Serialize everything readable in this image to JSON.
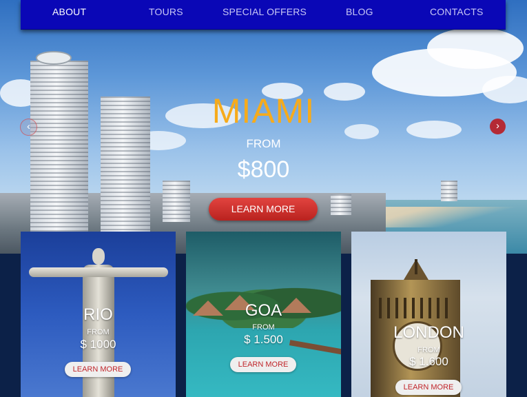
{
  "nav": {
    "items": [
      {
        "label": "ABOUT",
        "active": true
      },
      {
        "label": "TOURS",
        "active": false
      },
      {
        "label": "SPECIAL OFFERS",
        "active": false
      },
      {
        "label": "BLOG",
        "active": false
      },
      {
        "label": "CONTACTS",
        "active": false
      }
    ]
  },
  "hero": {
    "city": "MIAMI",
    "from_label": "FROM",
    "price": "$800",
    "button_label": "LEARN MORE",
    "prev_icon": "‹",
    "next_icon": "›"
  },
  "cards": [
    {
      "city": "RIO",
      "from_label": "FROM",
      "price": "$ 1000",
      "button_label": "LEARN MORE"
    },
    {
      "city": "GOA",
      "from_label": "FROM",
      "price": "$ 1.500",
      "button_label": "LEARN MORE"
    },
    {
      "city": "LONDON",
      "from_label": "FROM",
      "price": "$ 1.600",
      "button_label": "LEARN MORE"
    }
  ],
  "colors": {
    "nav_bg": "#0a07b6",
    "hero_city": "#f6ab1c",
    "button_red": "#d3322f",
    "page_bg": "#0c2148"
  }
}
